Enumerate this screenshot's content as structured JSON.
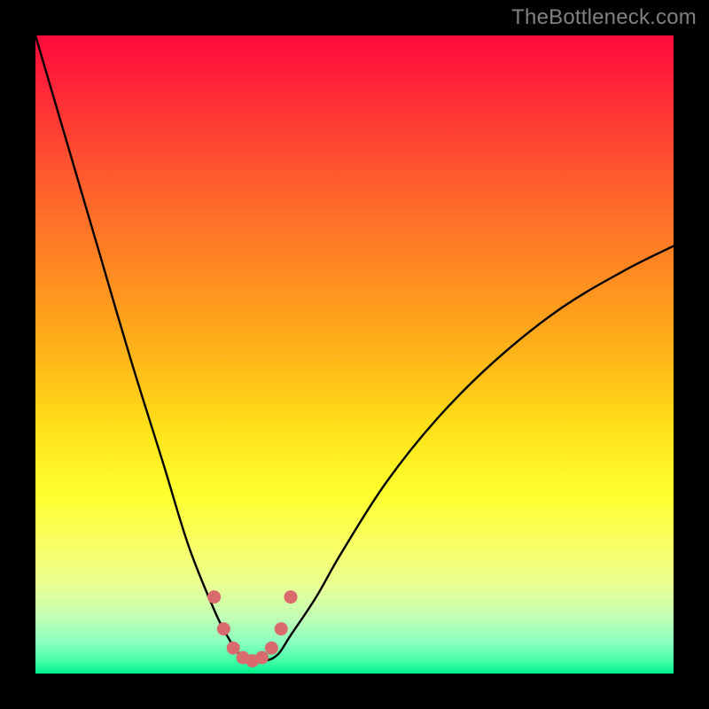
{
  "watermark": {
    "text": "TheBottleneck.com"
  },
  "chart_data": {
    "type": "line",
    "title": "",
    "xlabel": "",
    "ylabel": "",
    "ylim": [
      0,
      100
    ],
    "xlim": [
      0,
      100
    ],
    "series": [
      {
        "name": "bottleneck-curve",
        "x": [
          0,
          5,
          10,
          15,
          20,
          24,
          28,
          30,
          32,
          34,
          36,
          38,
          40,
          44,
          48,
          55,
          63,
          72,
          82,
          92,
          100
        ],
        "values": [
          100,
          83,
          66,
          49,
          33,
          20,
          10,
          6,
          3,
          2,
          2,
          3,
          6,
          12,
          19,
          30,
          40,
          49,
          57,
          63,
          67
        ]
      },
      {
        "name": "optimal-marker",
        "x": [
          28,
          29.5,
          31,
          32.5,
          34,
          35.5,
          37,
          38.5,
          40
        ],
        "values": [
          12,
          7,
          4,
          2.5,
          2,
          2.5,
          4,
          7,
          12
        ]
      }
    ],
    "colors": {
      "bottleneck-curve": "#000000",
      "optimal-marker": "#d96a6d"
    },
    "marker_radius": 7.5
  }
}
